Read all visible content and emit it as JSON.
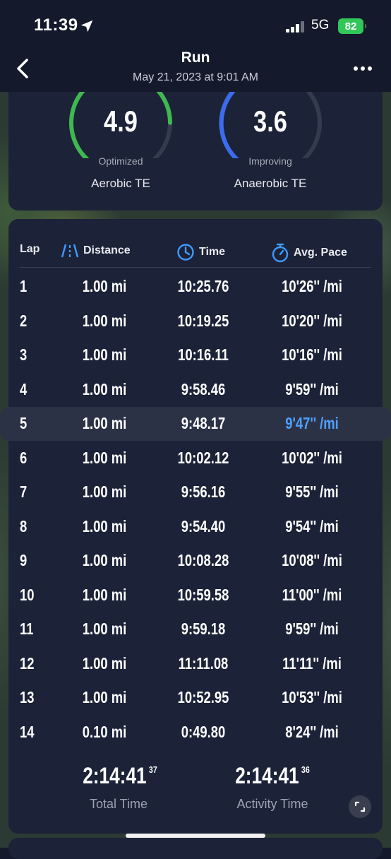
{
  "status_bar": {
    "time": "11:39",
    "network": "5G",
    "battery": "82"
  },
  "header": {
    "title": "Run",
    "subtitle": "May 21, 2023 at 9:01 AM"
  },
  "training_effect": {
    "aerobic": {
      "value": "4.9",
      "status": "Optimized",
      "label": "Aerobic TE",
      "color": "#3fb84f",
      "fraction": 0.82
    },
    "anaerobic": {
      "value": "3.6",
      "status": "Improving",
      "label": "Anaerobic TE",
      "color": "#3b6cf0",
      "fraction": 0.62
    }
  },
  "laps_table": {
    "headers": {
      "lap": "Lap",
      "distance": "Distance",
      "time": "Time",
      "pace": "Avg. Pace"
    },
    "rows": [
      {
        "lap": "1",
        "distance": "1.00 mi",
        "time": "10:25.76",
        "pace": "10'26'' /mi"
      },
      {
        "lap": "2",
        "distance": "1.00 mi",
        "time": "10:19.25",
        "pace": "10'20'' /mi"
      },
      {
        "lap": "3",
        "distance": "1.00 mi",
        "time": "10:16.11",
        "pace": "10'16'' /mi"
      },
      {
        "lap": "4",
        "distance": "1.00 mi",
        "time": "9:58.46",
        "pace": "9'59'' /mi"
      },
      {
        "lap": "5",
        "distance": "1.00 mi",
        "time": "9:48.17",
        "pace": "9'47'' /mi"
      },
      {
        "lap": "6",
        "distance": "1.00 mi",
        "time": "10:02.12",
        "pace": "10'02'' /mi"
      },
      {
        "lap": "7",
        "distance": "1.00 mi",
        "time": "9:56.16",
        "pace": "9'55'' /mi"
      },
      {
        "lap": "8",
        "distance": "1.00 mi",
        "time": "9:54.40",
        "pace": "9'54'' /mi"
      },
      {
        "lap": "9",
        "distance": "1.00 mi",
        "time": "10:08.28",
        "pace": "10'08'' /mi"
      },
      {
        "lap": "10",
        "distance": "1.00 mi",
        "time": "10:59.58",
        "pace": "11'00'' /mi"
      },
      {
        "lap": "11",
        "distance": "1.00 mi",
        "time": "9:59.18",
        "pace": "9'59'' /mi"
      },
      {
        "lap": "12",
        "distance": "1.00 mi",
        "time": "11:11.08",
        "pace": "11'11'' /mi"
      },
      {
        "lap": "13",
        "distance": "1.00 mi",
        "time": "10:52.95",
        "pace": "10'53'' /mi"
      },
      {
        "lap": "14",
        "distance": "0.10 mi",
        "time": "0:49.80",
        "pace": "8'24'' /mi"
      }
    ],
    "highlighted_lap": "5",
    "best_pace_color": "#4ea0ff"
  },
  "summary": {
    "total_time": {
      "value": "2:14:41",
      "hundredths": "37",
      "label": "Total Time"
    },
    "activity_time": {
      "value": "2:14:41",
      "hundredths": "36",
      "label": "Activity Time"
    }
  }
}
